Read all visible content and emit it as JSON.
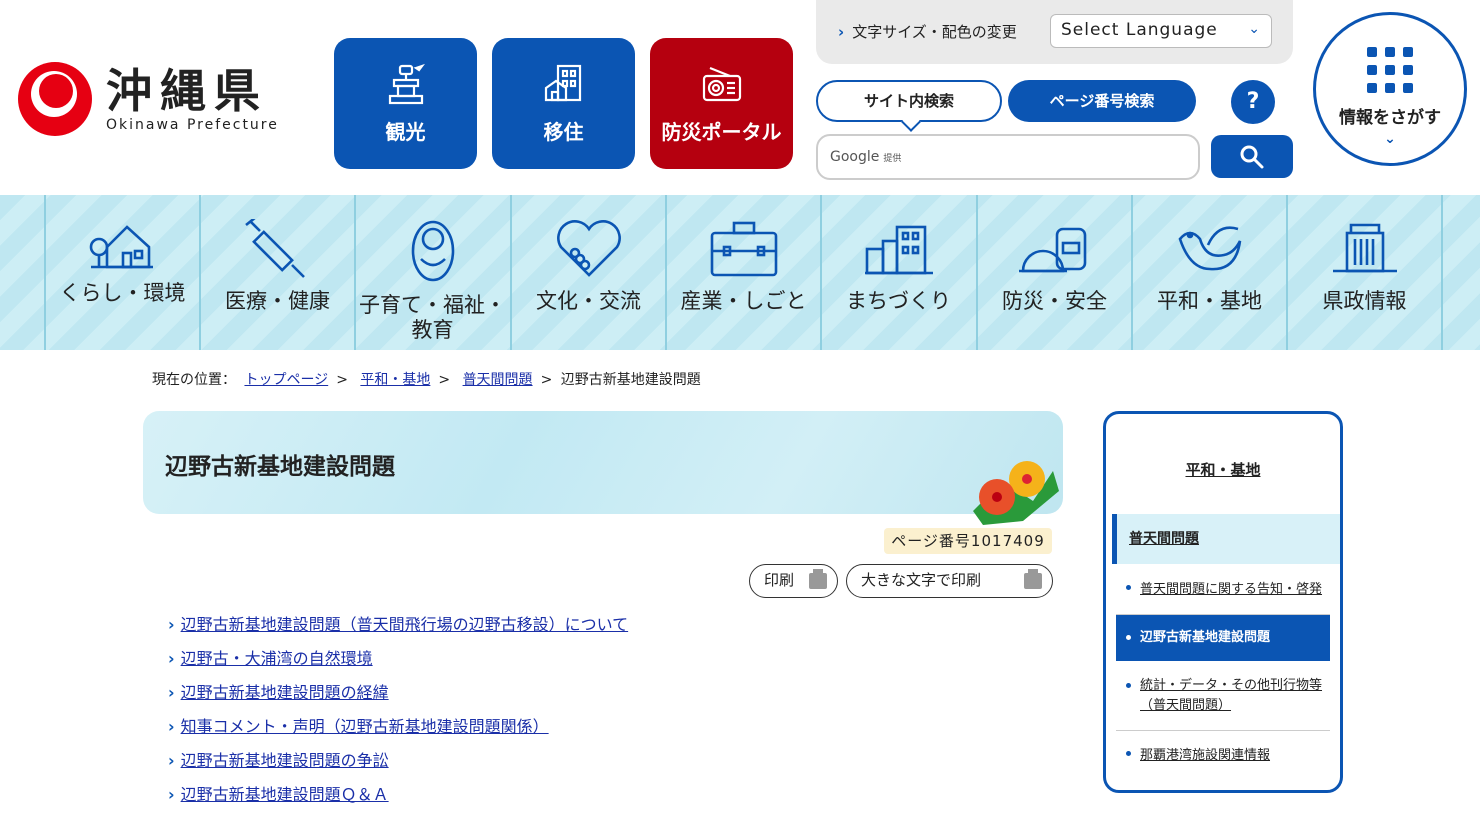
{
  "logo": {
    "name_jp": "沖縄県",
    "name_en": "Okinawa Prefecture"
  },
  "quick_links": [
    {
      "label": "観光",
      "icon": "tower-icon"
    },
    {
      "label": "移住",
      "icon": "building-icon"
    },
    {
      "label": "防災ポータル",
      "icon": "radio-icon"
    }
  ],
  "tools": {
    "text_color_link": "文字サイズ・配色の変更",
    "language_select": "Select Language"
  },
  "search": {
    "tab_site": "サイト内検索",
    "tab_page_number": "ページ番号検索",
    "help": "?",
    "placeholder_brand": "Google",
    "placeholder_suffix": "提供"
  },
  "find_info": {
    "label": "情報をさがす"
  },
  "global_nav": [
    {
      "label": "くらし・環境"
    },
    {
      "label": "医療・健康"
    },
    {
      "label": "子育て・福祉・教育"
    },
    {
      "label": "文化・交流"
    },
    {
      "label": "産業・しごと"
    },
    {
      "label": "まちづくり"
    },
    {
      "label": "防災・安全"
    },
    {
      "label": "平和・基地"
    },
    {
      "label": "県政情報"
    }
  ],
  "breadcrumb": {
    "prefix": "現在の位置：",
    "items": [
      "トップページ",
      "平和・基地",
      "普天間問題"
    ],
    "current": "辺野古新基地建設問題",
    "separator": ">"
  },
  "page": {
    "title": "辺野古新基地建設問題",
    "page_number": "ページ番号1017409",
    "print": "印刷",
    "print_large": "大きな文字で印刷"
  },
  "links": [
    "辺野古新基地建設問題（普天間飛行場の辺野古移設）について",
    "辺野古・大浦湾の自然環境",
    "辺野古新基地建設問題の経緯",
    "知事コメント・声明（辺野古新基地建設問題関係）",
    "辺野古新基地建設問題の争訟",
    "辺野古新基地建設問題Ｑ＆Ａ"
  ],
  "side_nav": {
    "heading": "平和・基地",
    "sub_heading": "普天間問題",
    "items": [
      "普天間問題に関する告知・啓発",
      "辺野古新基地建設問題",
      "統計・データ・その他刊行物等（普天間問題）",
      "那覇港湾施設関連情報"
    ],
    "active_index": 1
  },
  "colors": {
    "primary": "#0b55b3",
    "danger": "#b5000f",
    "logo_red": "#e60012",
    "nav_bg": "#c6eaf3"
  }
}
